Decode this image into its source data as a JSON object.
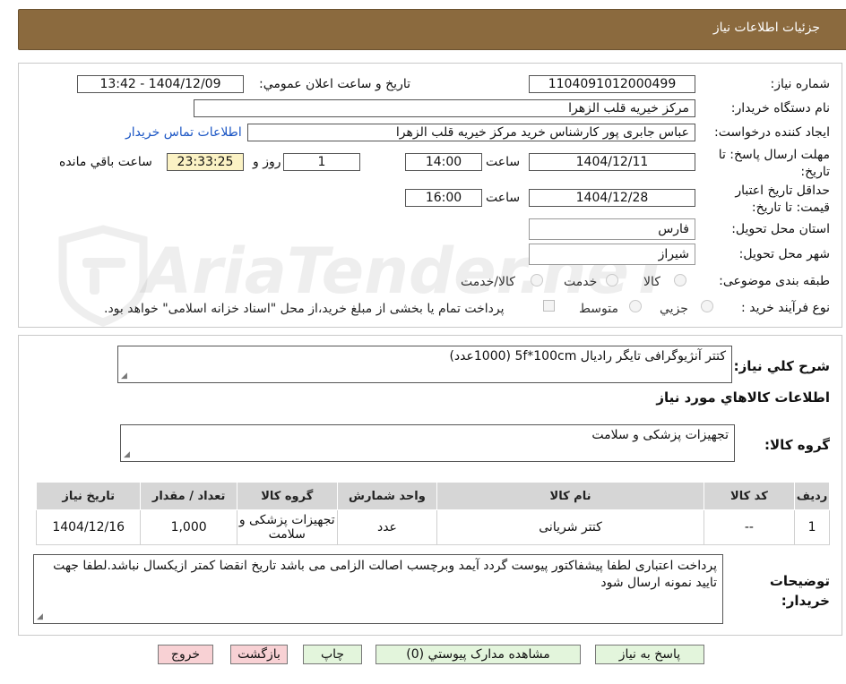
{
  "header": {
    "title": "جزئیات اطلاعات نیاز"
  },
  "watermark": {
    "text": "AriaTender.neT"
  },
  "form": {
    "need_number_label": "شماره نیاز:",
    "need_number": "1104091012000499",
    "announce_label": "تاریخ و ساعت اعلان عمومي:",
    "announce_value": "1404/12/09 - 13:42",
    "buyer_org_label": "نام دستگاه خريدار:",
    "buyer_org": "مرکز خیریه قلب الزهرا",
    "requester_label": "ايجاد کننده درخواست:",
    "requester": "عباس جابری پور کارشناس خرید مرکز خیریه قلب الزهرا",
    "contact_link": "اطلاعات تماس خريدار",
    "deadline_label": "مهلت ارسال پاسخ: تا تاریخ:",
    "deadline_date": "1404/12/11",
    "time_label": "ساعت",
    "deadline_time": "14:00",
    "days_value": "1",
    "days_label": "روز و",
    "remaining_time": "23:33:25",
    "remaining_label": "ساعت باقي مانده",
    "price_validity_label": "حداقل تاريخ اعتبار قيمت: تا تاريخ:",
    "price_validity_date": "1404/12/28",
    "price_validity_time": "16:00",
    "province_label": "استان محل تحويل:",
    "province": "فارس",
    "city_label": "شهر محل تحويل:",
    "city": "شیراز",
    "category_label": "طبقه بندی موضوعی:",
    "category_options": [
      "کالا",
      "خدمت",
      "کالا/خدمت"
    ],
    "process_label": "نوع فرآيند خريد :",
    "process_options": [
      "جزيي",
      "متوسط"
    ],
    "payment_note": "پرداخت تمام يا بخشی از مبلغ خريد،از محل \"اسناد خزانه اسلامی\" خواهد بود."
  },
  "summary": {
    "general_desc_label": "شرح کلي نياز:",
    "general_desc": "کتتر آنژیوگرافی تایگر رادیال 5f*100cm   (1000عدد)",
    "items_section_title": "اطلاعات کالاهاي مورد نياز",
    "goods_group_label": "گروه کالا:",
    "goods_group": "تجهیزات پزشکی و سلامت",
    "table": {
      "headers": [
        "رديف",
        "کد کالا",
        "نام کالا",
        "واحد شمارش",
        "گروه کالا",
        "تعداد / مقدار",
        "تاريخ نياز"
      ],
      "rows": [
        [
          "1",
          "--",
          "کتتر شریانی",
          "عدد",
          "تجهیزات پزشکی و سلامت",
          "1,000",
          "1404/12/16"
        ]
      ]
    },
    "buyer_notes_label": "توضيحات خريدار:",
    "buyer_notes": "پرداخت اعتباری لطفا پیشفاکتور پیوست گردد آیمد وبرچسب اصالت الزامی می باشد تاریخ انقضا کمتر ازیکسال نباشد.لطفا جهت تایید نمونه ارسال شود"
  },
  "buttons": {
    "reply": "پاسخ به نياز",
    "attachments": "مشاهده مدارک پيوستي (0)",
    "print": "چاپ",
    "back": "بازگشت",
    "exit": "خروج"
  },
  "colors": {
    "header_bg": "#8b6a3e",
    "link": "#1a55c4",
    "remaining_bg": "#fbf2c4",
    "green_button": "#e3f5dc",
    "pink_button": "#f8d1d4"
  }
}
